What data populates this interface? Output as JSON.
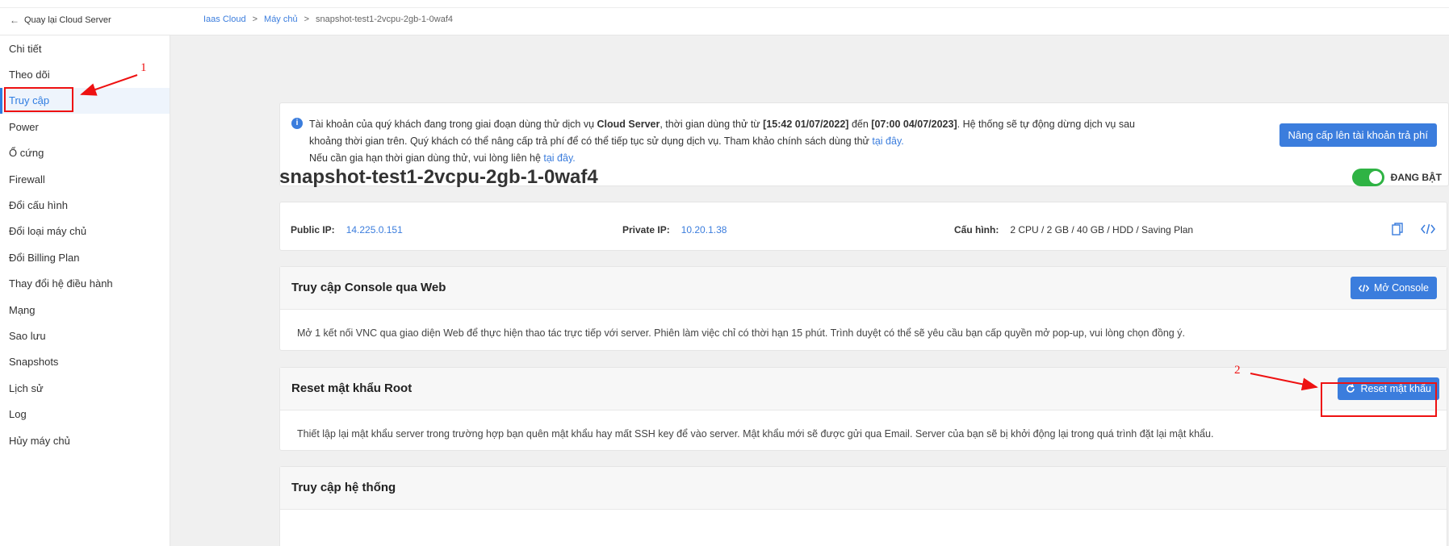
{
  "header": {
    "back_label": "Quay lại Cloud Server",
    "breadcrumb": [
      "Iaas Cloud",
      "Máy chủ",
      "snapshot-test1-2vcpu-2gb-1-0waf4"
    ],
    "separator": ">"
  },
  "sidebar": {
    "items": [
      {
        "label": "Chi tiết"
      },
      {
        "label": "Theo dõi"
      },
      {
        "label": "Truy cập",
        "active": true
      },
      {
        "label": "Power"
      },
      {
        "label": "Ổ cứng"
      },
      {
        "label": "Firewall"
      },
      {
        "label": "Đổi cấu hình"
      },
      {
        "label": "Đổi loại máy chủ"
      },
      {
        "label": "Đổi Billing Plan"
      },
      {
        "label": "Thay đổi hệ điều hành"
      },
      {
        "label": "Mạng"
      },
      {
        "label": "Sao lưu"
      },
      {
        "label": "Snapshots"
      },
      {
        "label": "Lịch sử"
      },
      {
        "label": "Log"
      },
      {
        "label": "Hủy máy chủ"
      }
    ]
  },
  "notice": {
    "l1_a": "Tài khoản của quý khách đang trong giai đoạn dùng thử dịch vụ ",
    "l1_b": "Cloud Server",
    "l1_c": ", thời gian dùng thử từ ",
    "l1_d": "[15:42 01/07/2022]",
    "l1_e": " đến ",
    "l1_f": "[07:00 04/07/2023]",
    "l1_g": ". Hệ thống sẽ tự động dừng dịch vụ sau",
    "l2_a": "khoảng thời gian trên. Quý khách có thể nâng cấp trả phí để có thể tiếp tục sử dụng dịch vụ. Tham khảo chính sách dùng thử ",
    "l2_link": "tại đây.",
    "l3_a": "Nếu cần gia hạn thời gian dùng thử, vui lòng liên hệ ",
    "l3_link": "tại đây.",
    "upgrade_button": "Nâng cấp lên tài khoản trả phí"
  },
  "server": {
    "name": "snapshot-test1-2vcpu-2gb-1-0waf4",
    "status": "ĐANG BẬT",
    "status_on": true,
    "public_ip_label": "Public IP:",
    "public_ip": "14.225.0.151",
    "private_ip_label": "Private IP:",
    "private_ip": "10.20.1.38",
    "config_label": "Cấu hình:",
    "config": "2 CPU / 2 GB / 40 GB / HDD / Saving Plan"
  },
  "console_card": {
    "title": "Truy cập Console qua Web",
    "button": "Mở Console",
    "body": "Mở 1 kết nối VNC qua giao diện Web để thực hiện thao tác trực tiếp với server. Phiên làm việc chỉ có thời hạn 15 phút. Trình duyệt có thể sẽ yêu cầu bạn cấp quyền mở pop-up, vui lòng chọn đồng ý."
  },
  "reset_card": {
    "title": "Reset mật khẩu Root",
    "button": "Reset mật khẩu",
    "body": "Thiết lập lại mật khẩu server trong trường hợp bạn quên mật khẩu hay mất SSH key để vào server. Mật khẩu mới sẽ được gửi qua Email. Server của bạn sẽ bị khởi động lại trong quá trình đặt lại mật khẩu."
  },
  "system_card": {
    "title": "Truy cập hệ thống"
  },
  "annotations": {
    "step1": "1",
    "step2": "2",
    "color": "#e11111"
  },
  "colors": {
    "accent": "#3b7ddd",
    "toggle_on": "#2fb344"
  }
}
